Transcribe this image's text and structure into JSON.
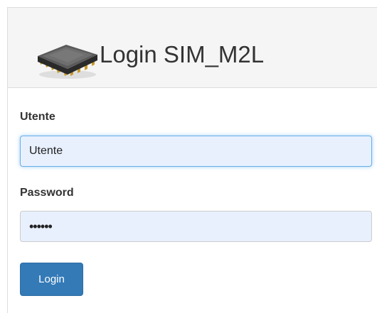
{
  "header": {
    "title": "Login SIM_M2L",
    "icon": "cpu-chip-icon"
  },
  "form": {
    "username": {
      "label": "Utente",
      "value": "Utente"
    },
    "password": {
      "label": "Password",
      "masked_value": "••••••"
    },
    "submit_label": "Login"
  },
  "colors": {
    "heading_bg": "#f5f5f5",
    "input_bg": "#e8f0fe",
    "button_bg": "#337ab7",
    "focus_border": "#66afe9"
  }
}
